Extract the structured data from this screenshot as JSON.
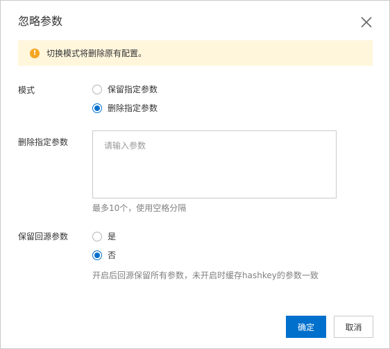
{
  "dialog": {
    "title": "忽略参数",
    "close_icon": "close-icon"
  },
  "alert": {
    "icon": "warning-icon",
    "text": "切换模式将删除原有配置。",
    "color": "#fff6dc"
  },
  "mode": {
    "label": "模式",
    "options": [
      {
        "label": "保留指定参数",
        "checked": false
      },
      {
        "label": "删除指定参数",
        "checked": true
      }
    ]
  },
  "params": {
    "label": "删除指定参数",
    "value": "",
    "placeholder": "请输入参数",
    "hint": "最多10个，使用空格分隔"
  },
  "keep_origin": {
    "label": "保留回源参数",
    "options": [
      {
        "label": "是",
        "checked": false
      },
      {
        "label": "否",
        "checked": true
      }
    ],
    "hint": "开启后回源保留所有参数，未开启时缓存hashkey的参数一致"
  },
  "footer": {
    "confirm_label": "确定",
    "cancel_label": "取消"
  },
  "colors": {
    "primary": "#0070cc",
    "warning": "#f5a623"
  }
}
